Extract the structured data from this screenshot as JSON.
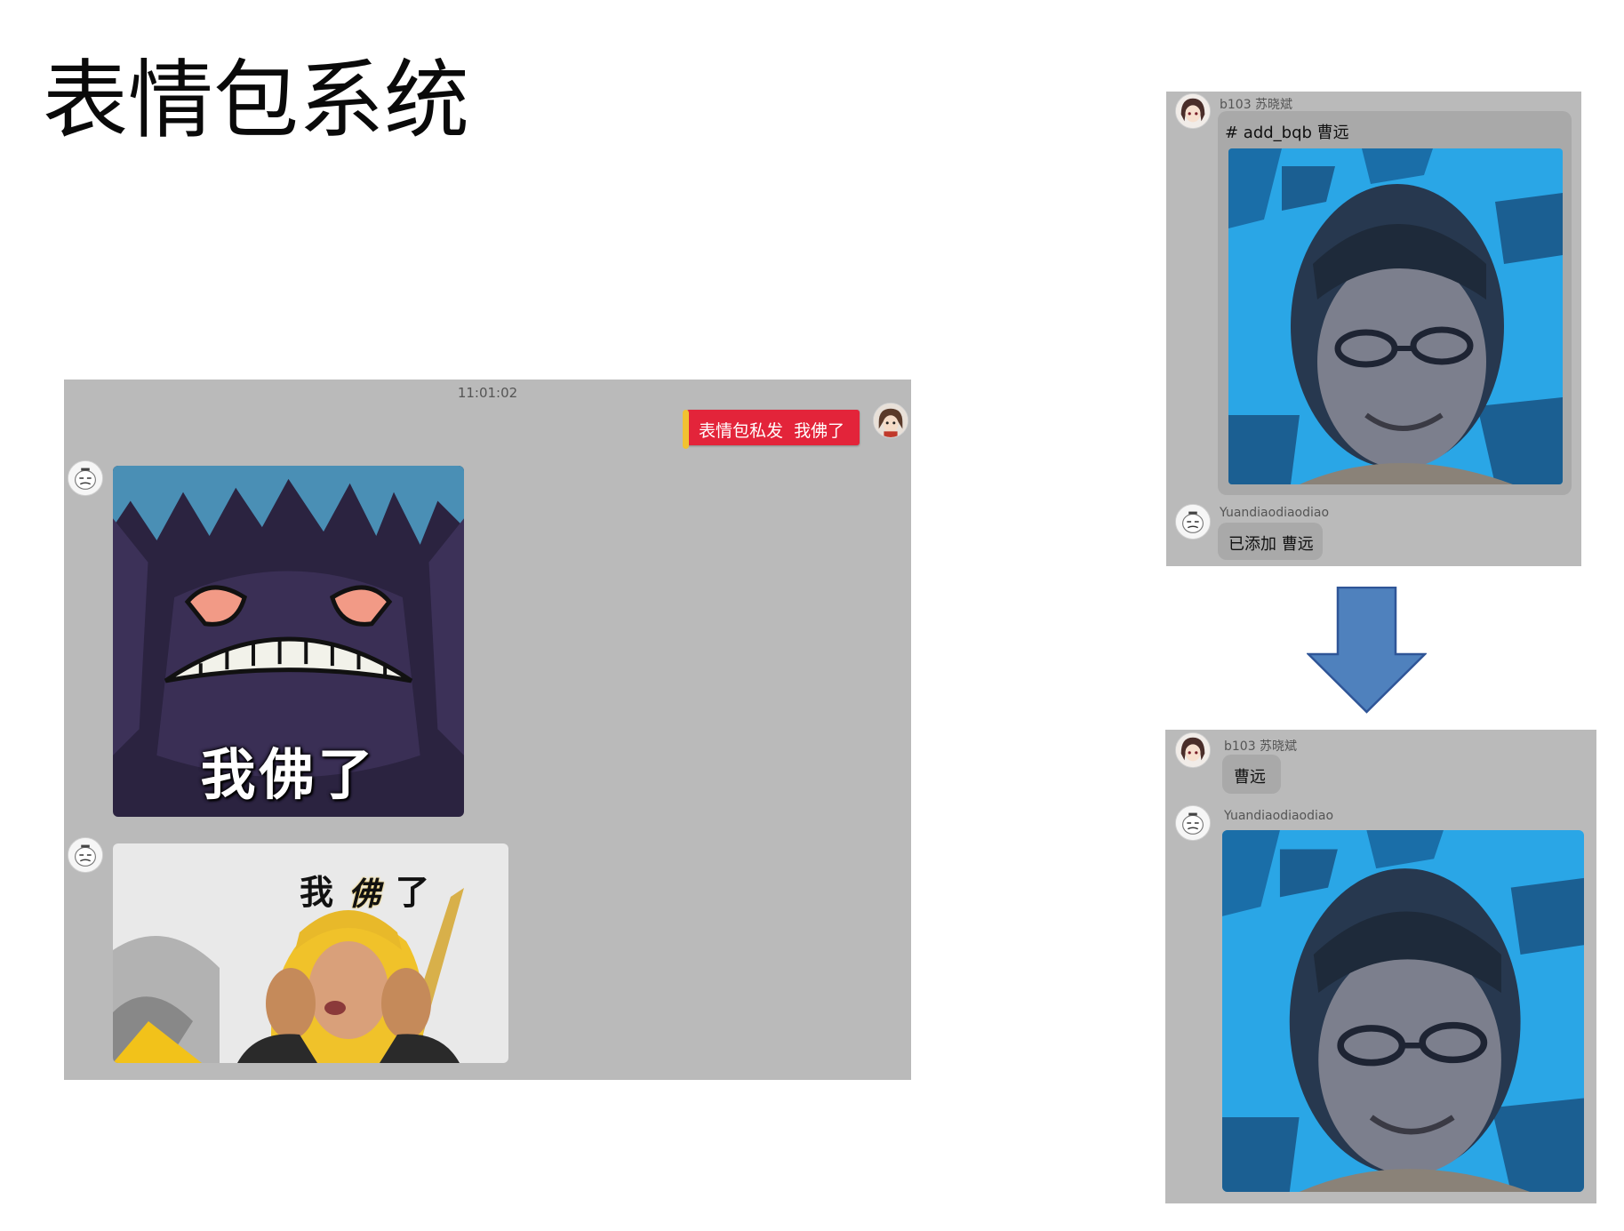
{
  "slide": {
    "title": "表情包系统"
  },
  "left_chat": {
    "timestamp": "11:01:02",
    "outgoing_message": "表情包私发  我佛了",
    "sticker1_caption": "我佛了",
    "sticker2_caption_left": "我",
    "sticker2_caption_mid": "佛",
    "sticker2_caption_right": "了"
  },
  "top_right_chat": {
    "user1_name": "b103 苏晓斌",
    "user1_message": "# add_bqb 曹远",
    "user2_name": "Yuandiaodiaodiao",
    "user2_message": "已添加 曹远"
  },
  "bottom_right_chat": {
    "user1_name": "b103 苏晓斌",
    "user1_message": "曹远",
    "user2_name": "Yuandiaodiaodiao"
  },
  "colors": {
    "panel_bg": "#bababa",
    "bubble_bg": "#a9a9a9",
    "outgoing_red": "#e3243a",
    "arrow_blue": "#4f81bd",
    "photo_blue": "#2aa6e6"
  }
}
